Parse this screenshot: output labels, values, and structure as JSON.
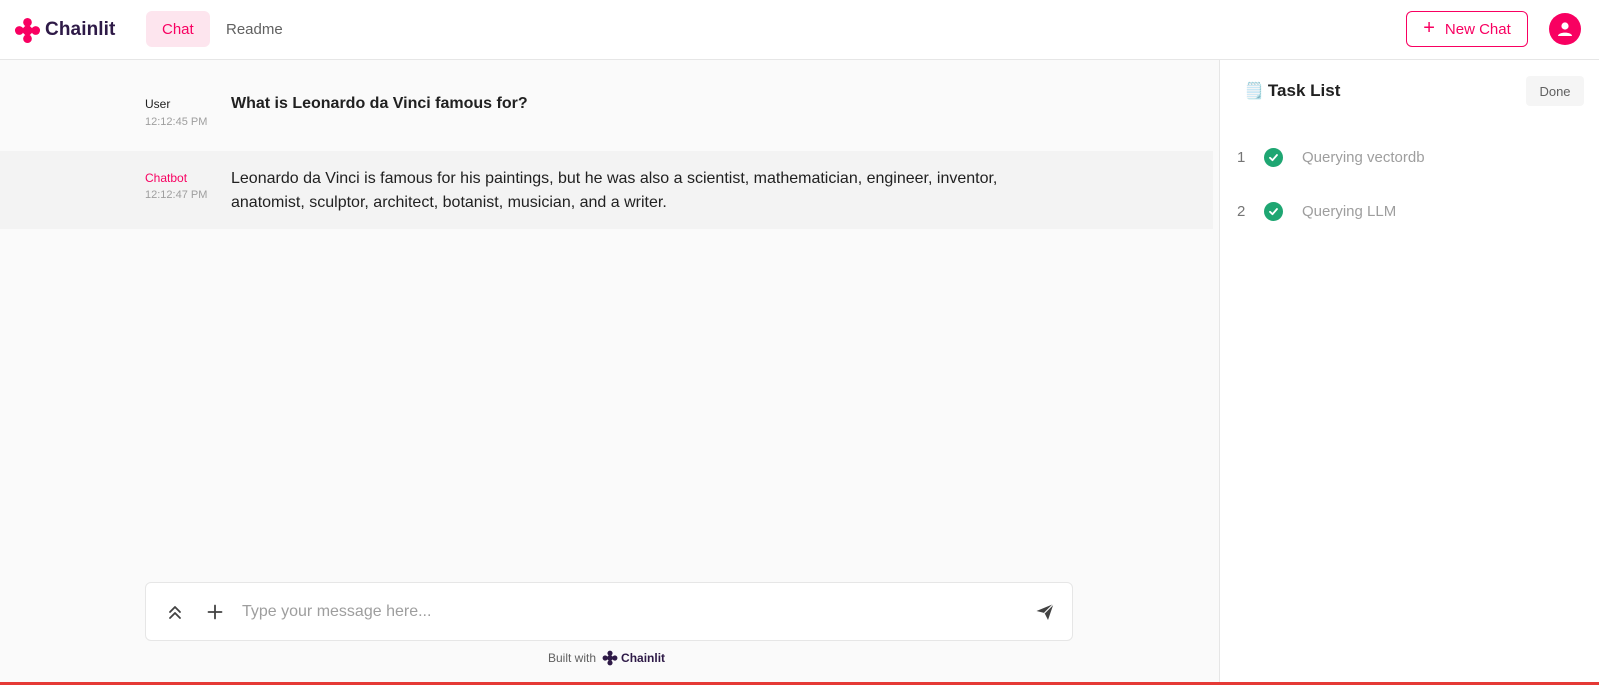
{
  "app": {
    "name": "Chainlit",
    "brand_color": "#f80061"
  },
  "nav": {
    "tabs": [
      {
        "label": "Chat",
        "active": true
      },
      {
        "label": "Readme",
        "active": false
      }
    ]
  },
  "header": {
    "new_chat_label": "New Chat",
    "avatar_icon": "user-icon"
  },
  "messages": [
    {
      "author": "User",
      "time": "12:12:45 PM",
      "content": "What is Leonardo da Vinci famous for?"
    },
    {
      "author": "Chatbot",
      "time": "12:12:47 PM",
      "content": "Leonardo da Vinci is famous for his paintings, but he was also a scientist, mathematician, engineer, inventor, anatomist, sculptor, architect, botanist, musician, and a writer."
    }
  ],
  "composer": {
    "placeholder": "Type your message here...",
    "value": ""
  },
  "footer": {
    "built_with": "Built with",
    "brand": "Chainlit"
  },
  "task_list": {
    "icon": "🗒️",
    "title": "Task List",
    "status": "Done",
    "tasks": [
      {
        "number": "1",
        "label": "Querying vectordb",
        "status": "done"
      },
      {
        "number": "2",
        "label": "Querying LLM",
        "status": "done"
      }
    ]
  }
}
